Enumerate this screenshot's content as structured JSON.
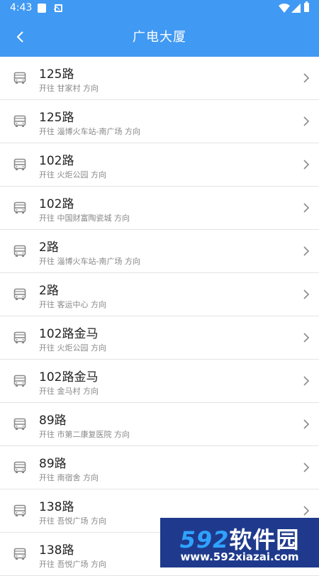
{
  "status_bar": {
    "time": "4:43"
  },
  "header": {
    "title": "广电大厦",
    "back_icon": "back-arrow-icon"
  },
  "routes": [
    {
      "name": "125路",
      "direction": "开往 甘家村 方向"
    },
    {
      "name": "125路",
      "direction": "开往 淄博火车站-南广场 方向"
    },
    {
      "name": "102路",
      "direction": "开往 火炬公园 方向"
    },
    {
      "name": "102路",
      "direction": "开往 中国财富陶瓷城 方向"
    },
    {
      "name": "2路",
      "direction": "开往 淄博火车站-南广场 方向"
    },
    {
      "name": "2路",
      "direction": "开往 客运中心 方向"
    },
    {
      "name": "102路金马",
      "direction": "开往 火炬公园 方向"
    },
    {
      "name": "102路金马",
      "direction": "开往 金马村 方向"
    },
    {
      "name": "89路",
      "direction": "开往 市第二康复医院 方向"
    },
    {
      "name": "89路",
      "direction": "开往 南宿舍 方向"
    },
    {
      "name": "138路",
      "direction": "开往 吾悦广场 方向"
    },
    {
      "name": "138路",
      "direction": "开往 吾悦广场 方向"
    }
  ],
  "watermark": {
    "logo_num": "592",
    "logo_text": "软件园",
    "url": "www.592xiazai.com"
  },
  "colors": {
    "header": "#4099f3",
    "background": "#f2f2f2",
    "watermark": "#1f3a8c"
  }
}
